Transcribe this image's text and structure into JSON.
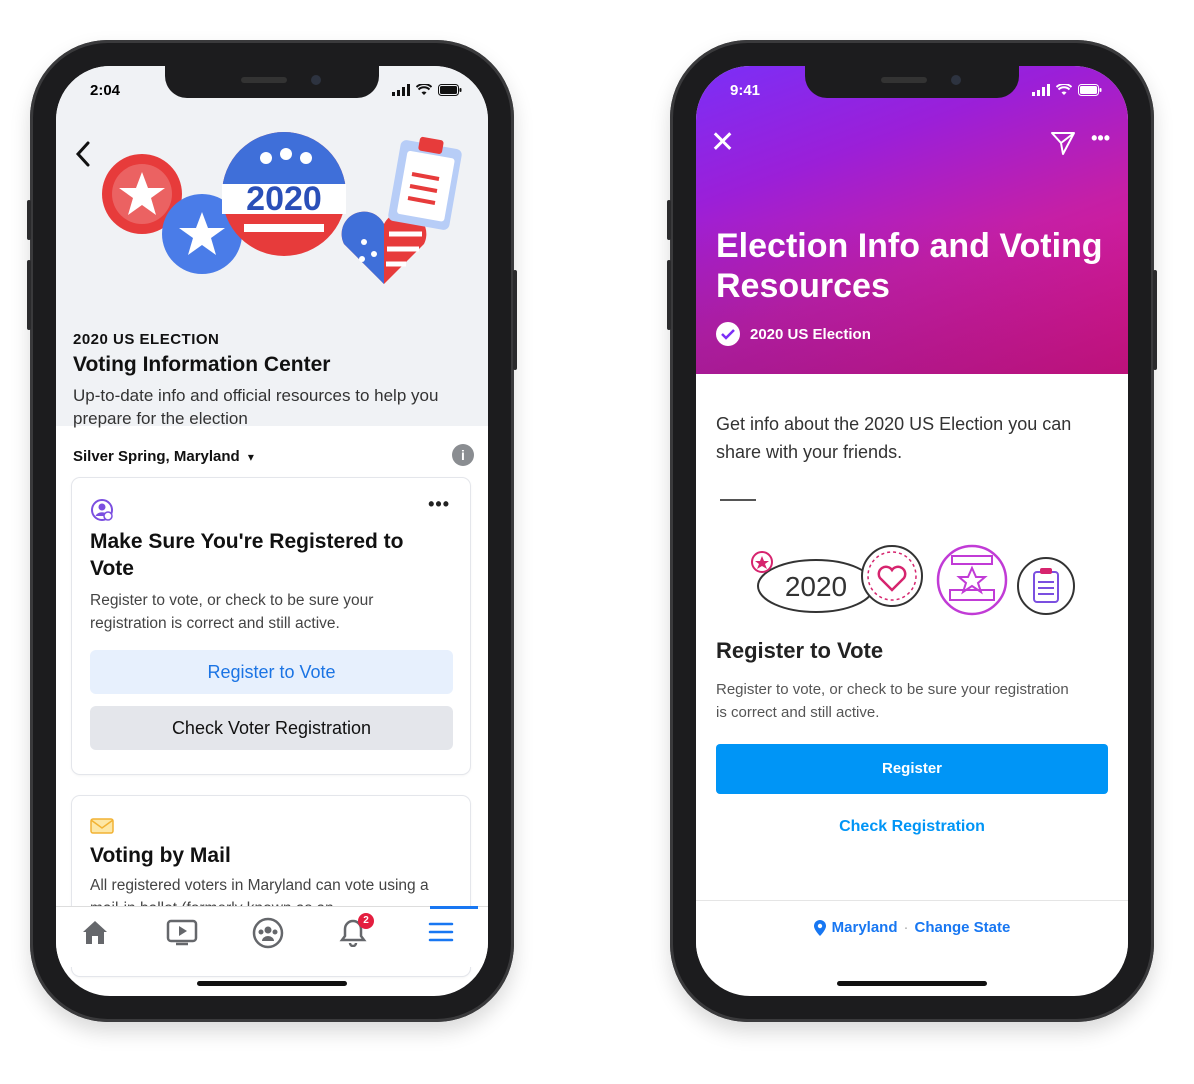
{
  "facebook": {
    "status_time": "2:04",
    "kicker": "2020 US ELECTION",
    "title": "Voting Information Center",
    "description": "Up-to-date info and official resources to help you prepare for the election",
    "location": "Silver Spring, Maryland",
    "location_caret": "▾",
    "info_glyph": "i",
    "card1": {
      "title": "Make Sure You're Registered to Vote",
      "text": "Register to vote, or check to be sure your registration is correct and still active.",
      "primary_button": "Register to Vote",
      "secondary_button": "Check Voter Registration",
      "more_glyph": "•••"
    },
    "card2": {
      "title": "Voting by Mail",
      "text": "All registered voters in Maryland can vote using a mail-in ballot (formerly known as an"
    },
    "tabbar": {
      "icons": [
        "home-icon",
        "watch-icon",
        "groups-icon",
        "notifications-icon",
        "menu-icon"
      ],
      "notification_count": "2",
      "active_color": "#1877f2"
    },
    "badge_text": "2020"
  },
  "instagram": {
    "status_time": "9:41",
    "close_glyph": "✕",
    "more_glyph": "•••",
    "title": "Election Info and Voting Resources",
    "subtitle": "2020 US Election",
    "intro": "Get info about the 2020 US Election you can share with your friends.",
    "illustration_badge": "2020",
    "section_title": "Register to Vote",
    "section_text": "Register to vote, or check to be sure your registration is correct and still active.",
    "primary_button": "Register",
    "secondary_link": "Check Registration",
    "footer": {
      "location": "Maryland",
      "separator": "·",
      "action": "Change State"
    },
    "gradient_colors": [
      "#7b2ff7",
      "#c51fa6",
      "#e8117b"
    ],
    "accent_color": "#0095f6"
  }
}
